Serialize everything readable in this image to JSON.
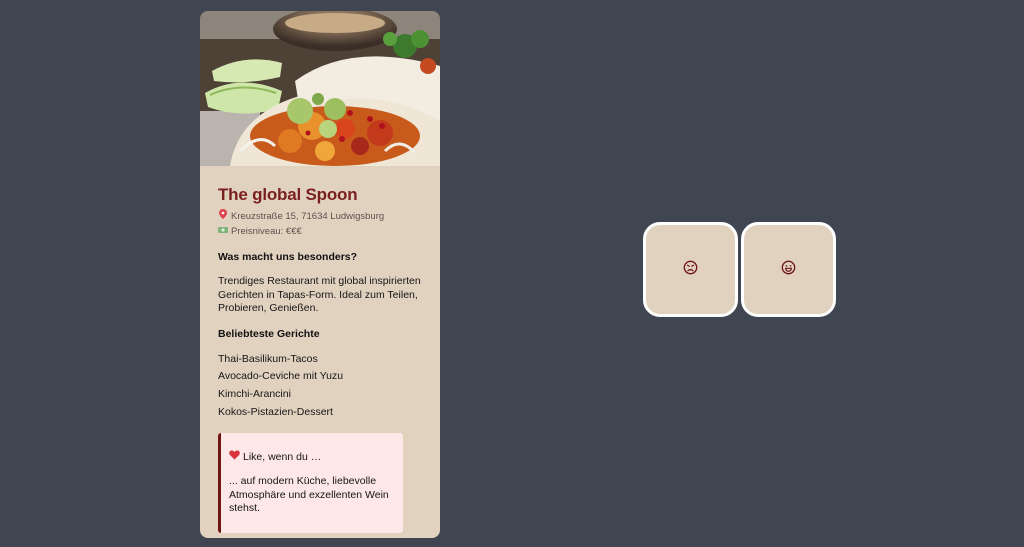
{
  "restaurant": {
    "name": "The global Spoon",
    "address_icon": "pin-icon",
    "address": "Kreuzstraße 15, 71634 Ludwigsburg",
    "price_icon": "money-icon",
    "price": "Preisniveau: €€€",
    "special_heading": "Was macht uns besonders?",
    "description": "Trendiges Restaurant mit global inspirierten Gerichten in Tapas-Form. Ideal zum Teilen, Probieren, Genießen.",
    "dishes_heading": "Beliebteste Gerichte",
    "dishes": [
      "Thai-Basilikum-Tacos",
      "Avocado-Ceviche mit Yuzu",
      "Kimchi-Arancini",
      "Kokos-Pistazien-Dessert"
    ],
    "like_heading": "Like, wenn du …",
    "like_text": "... auf modern Küche, liebevolle Atmosphäre und exzellenten Wein stehst."
  },
  "actions": {
    "dislike_icon": "sad-face-icon",
    "like_icon": "happy-face-icon"
  },
  "colors": {
    "background": "#3f4651",
    "card": "#e1d2bf",
    "title": "#7a1f1f",
    "like_box": "#fde7e7",
    "like_border": "#6e1414",
    "icon_stroke": "#6e1414"
  }
}
